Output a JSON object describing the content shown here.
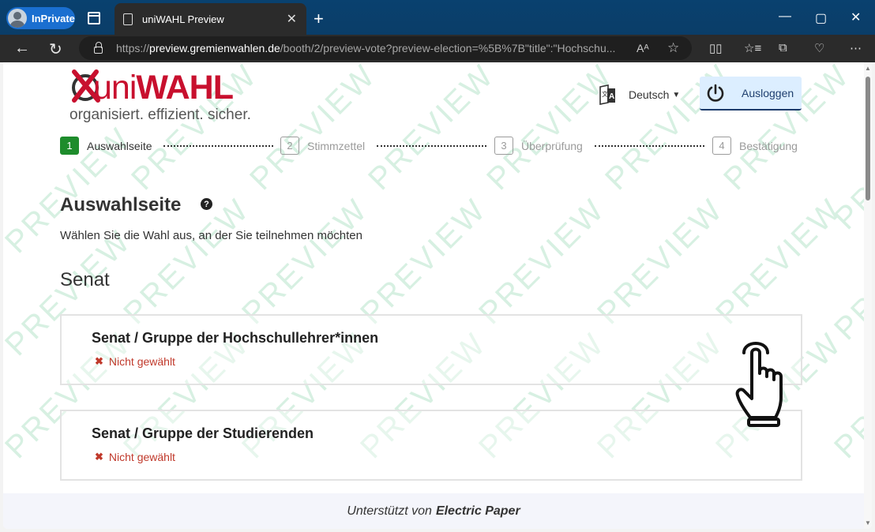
{
  "browser": {
    "inprivate_label": "InPrivate",
    "tab_title": "uniWAHL Preview",
    "url_prefix": "https://",
    "url_domain": "preview.gremienwahlen.de",
    "url_rest": "/booth/2/preview-vote?preview-election=%5B%7B\"title\":\"Hochschu..."
  },
  "header": {
    "brand_uni": "uni",
    "brand_wahl": "WAHL",
    "tagline": "organisiert. effizient. sicher.",
    "language": "Deutsch",
    "logout_label": "Ausloggen"
  },
  "steps": [
    {
      "num": "1",
      "label": "Auswahlseite"
    },
    {
      "num": "2",
      "label": "Stimmzettel"
    },
    {
      "num": "3",
      "label": "Überprüfung"
    },
    {
      "num": "4",
      "label": "Bestätigung"
    }
  ],
  "main": {
    "title": "Auswahlseite",
    "help_glyph": "?",
    "subtitle": "Wählen Sie die Wahl aus, an der Sie teilnehmen möchten",
    "section_title": "Senat",
    "elections": [
      {
        "title": "Senat / Gruppe der Hochschullehrer*innen",
        "status": "Nicht gewählt"
      },
      {
        "title": "Senat / Gruppe der Studierenden",
        "status": "Nicht gewählt"
      }
    ]
  },
  "watermark_text": "PREVIEW",
  "footer": {
    "prefix": "Unterstützt von",
    "company": "Electric Paper"
  },
  "colors": {
    "brand_red": "#c8102e",
    "step_active": "#1e8c2c",
    "status_red": "#c0392b",
    "logout_bg": "#dceeff"
  }
}
